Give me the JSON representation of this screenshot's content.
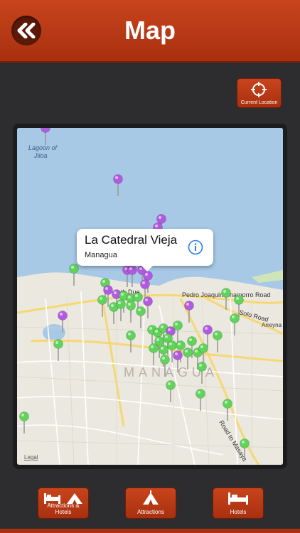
{
  "header": {
    "title": "Map",
    "back_icon": "double-chevron-left-icon"
  },
  "current_location": {
    "label": "Current Location",
    "icon": "crosshair-icon"
  },
  "map": {
    "lake_label_line1": "Lagoon of",
    "lake_label_line2": "Jiloa",
    "city_label": "MANAGUA",
    "road_1": "Pedro Joaquin Chamorro Road",
    "road_2": "Solo Road",
    "road_3": "Arreyna",
    "road_4": "Road to Masaya",
    "street_fragment": "th Due",
    "legal": "Legal",
    "callout": {
      "title": "La Catedral Vieja",
      "subtitle": "Managua",
      "info_icon": "info-icon"
    },
    "pin_colors": {
      "green": "#5fd35a",
      "purple": "#b15be0"
    }
  },
  "tabs": [
    {
      "label": "Attractions & Hotels",
      "icon": "bed-and-tent-icon"
    },
    {
      "label": "Attractions",
      "icon": "tent-icon"
    },
    {
      "label": "Hotels",
      "icon": "bed-icon"
    }
  ]
}
